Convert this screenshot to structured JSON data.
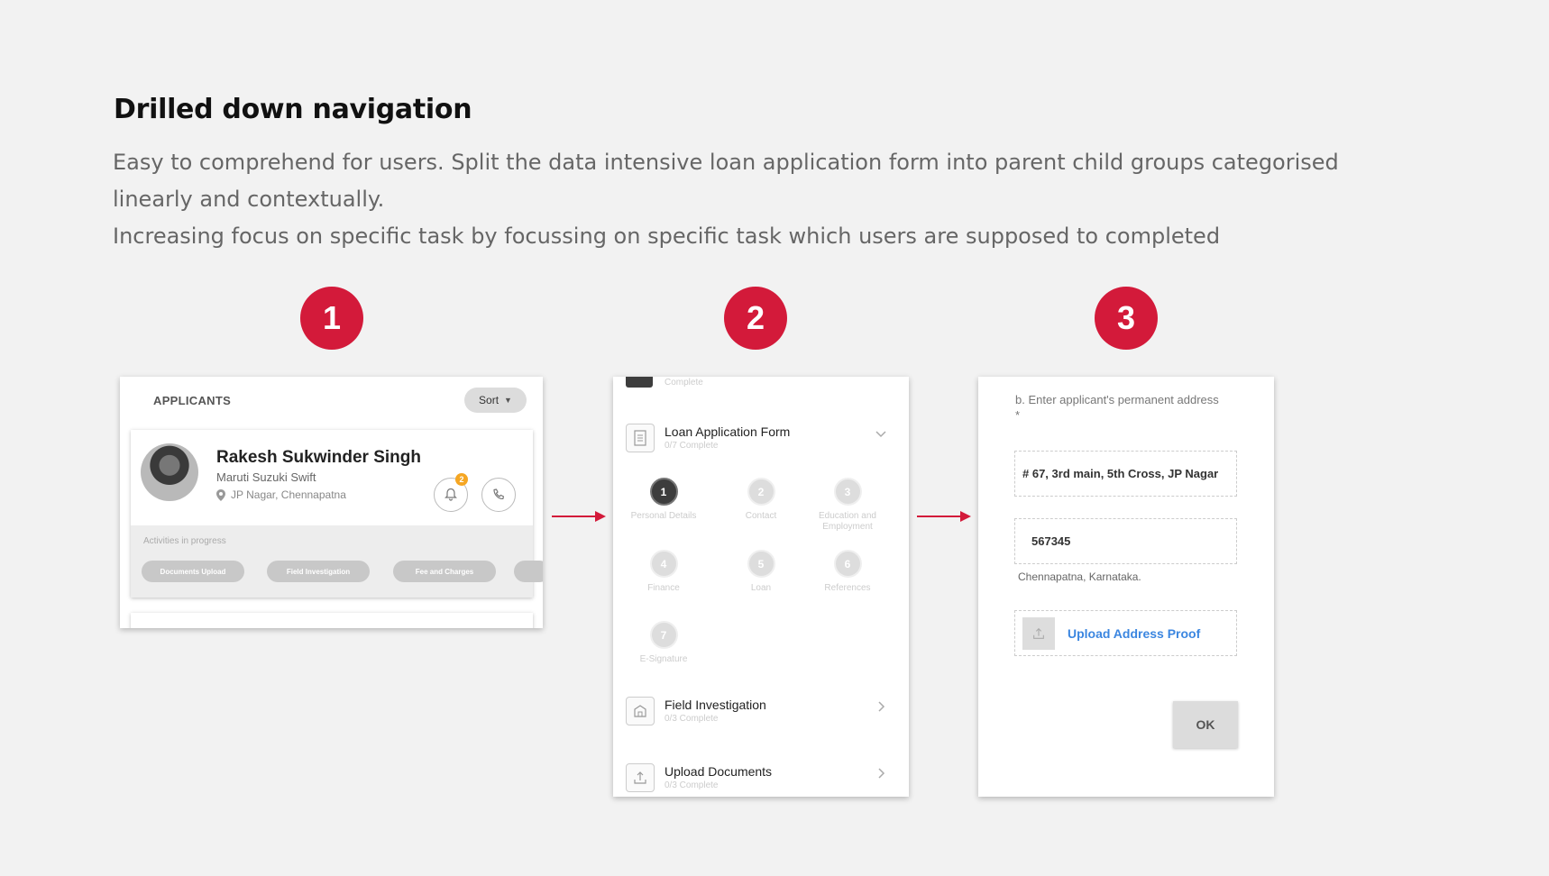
{
  "header": {
    "title": "Drilled down navigation",
    "description_line1": "Easy to comprehend for users. Split the data intensive loan application form into parent child groups categorised linearly and contextually.",
    "description_line2": "Increasing focus on specific task by focussing on specific task which users are supposed to completed"
  },
  "steps": [
    "1",
    "2",
    "3"
  ],
  "colors": {
    "accent": "#d31a3a",
    "link": "#3b86e0",
    "badge": "#f5a623"
  },
  "screen1": {
    "title": "APPLICANTS",
    "sort_label": "Sort",
    "applicant": {
      "name": "Rakesh Sukwinder Singh",
      "vehicle": "Maruti Suzuki Swift",
      "location": "JP Nagar, Chennapatna",
      "notification_count": "2"
    },
    "activities_label": "Activities in progress",
    "chips": [
      "Documents Upload",
      "Field Investigation",
      "Fee and Charges"
    ]
  },
  "screen2": {
    "top_status": "Complete",
    "loan_form": {
      "title": "Loan Application Form",
      "subtitle": "0/7 Complete"
    },
    "steps": [
      {
        "num": "1",
        "label": "Personal Details",
        "active": true
      },
      {
        "num": "2",
        "label": "Contact",
        "active": false
      },
      {
        "num": "3",
        "label": "Education and Employment",
        "active": false
      },
      {
        "num": "4",
        "label": "Finance",
        "active": false
      },
      {
        "num": "5",
        "label": "Loan",
        "active": false
      },
      {
        "num": "6",
        "label": "References",
        "active": false
      },
      {
        "num": "7",
        "label": "E-Signature",
        "active": false
      }
    ],
    "field_investigation": {
      "title": "Field Investigation",
      "subtitle": "0/3 Complete"
    },
    "upload_documents": {
      "title": "Upload Documents",
      "subtitle": "0/3 Complete"
    }
  },
  "screen3": {
    "address_label": "b. Enter applicant's permanent address *",
    "address_value": "# 67, 3rd main, 5th Cross, JP Nagar",
    "pincode_value": "567345",
    "helper": "Chennapatna, Karnataka.",
    "upload_label": "Upload Address Proof",
    "ok_label": "OK"
  }
}
